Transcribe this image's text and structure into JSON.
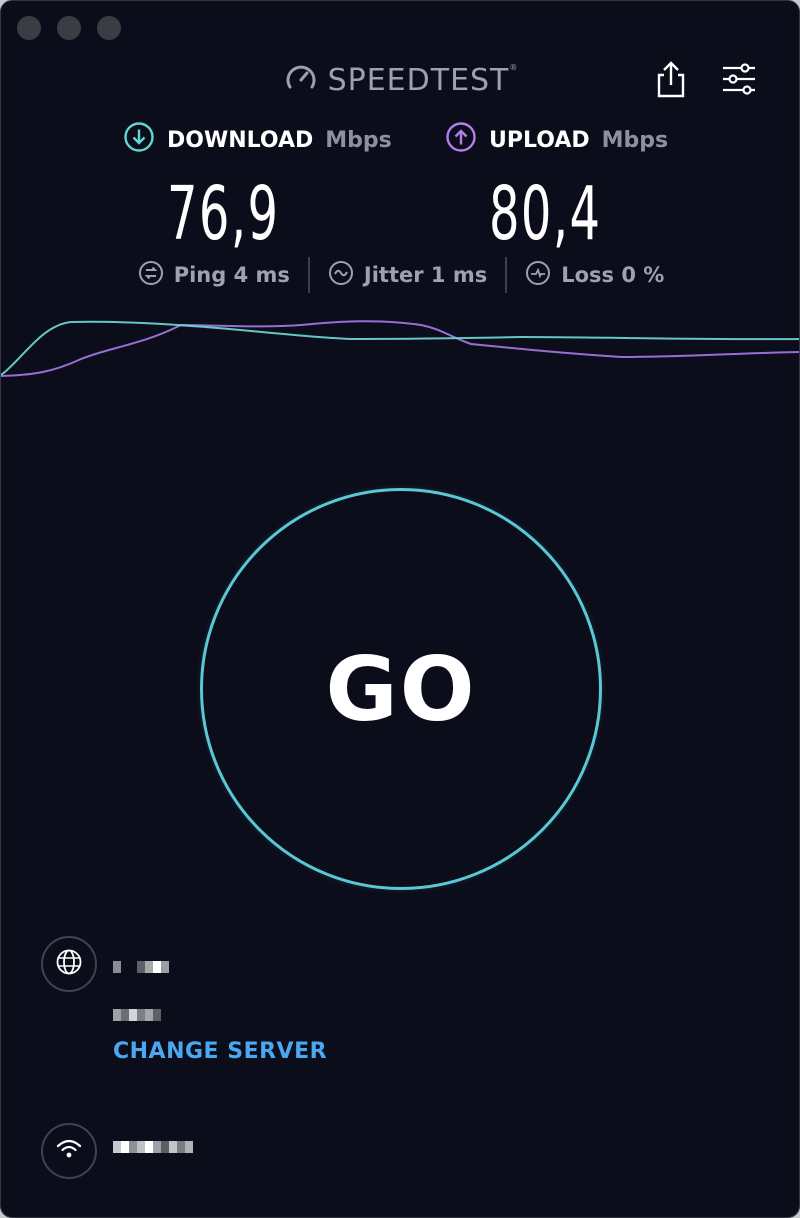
{
  "app": {
    "brand": "SPEEDTEST",
    "trademark": "®"
  },
  "download": {
    "label": "DOWNLOAD",
    "unit": "Mbps",
    "value": "76,9",
    "color": "#62d6d2"
  },
  "upload": {
    "label": "UPLOAD",
    "unit": "Mbps",
    "value": "80,4",
    "color": "#b37feb"
  },
  "stats": {
    "ping": "Ping 4 ms",
    "jitter": "Jitter 1 ms",
    "loss": "Loss 0 %"
  },
  "go_button": {
    "label": "GO",
    "ring_color": "#5ac7d4"
  },
  "server": {
    "change_label": "CHANGE SERVER",
    "link_color": "#4aa8f0"
  },
  "icons": {
    "share": "share-icon",
    "settings": "sliders-icon",
    "globe": "globe-icon",
    "wifi": "wifi-icon"
  }
}
